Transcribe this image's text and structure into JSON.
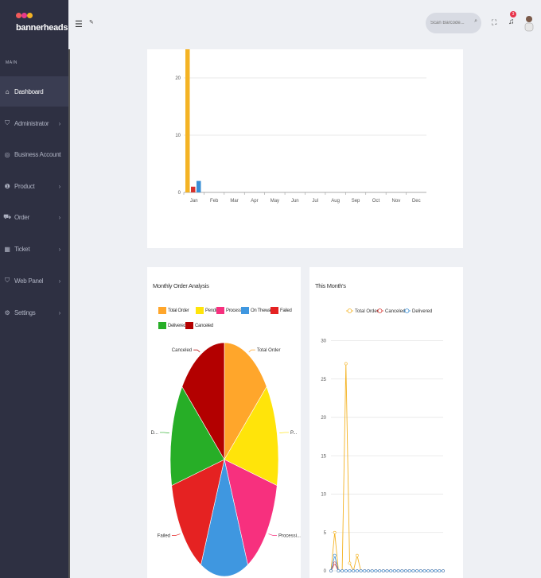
{
  "brand": {
    "name": "bannerheads",
    "dot_colors": [
      "#f15a5a",
      "#e63a8a",
      "#f4b324"
    ]
  },
  "sidebar": {
    "section_label": "MAIN",
    "items": [
      {
        "label": "Dashboard",
        "icon": "home-icon",
        "active": true
      },
      {
        "label": "Administrator",
        "icon": "shield-icon"
      },
      {
        "label": "Business Account",
        "icon": "account-icon"
      },
      {
        "label": "Product",
        "icon": "product-icon"
      },
      {
        "label": "Order",
        "icon": "cart-icon"
      },
      {
        "label": "Ticket",
        "icon": "ticket-icon"
      },
      {
        "label": "Web Panel",
        "icon": "web-icon"
      },
      {
        "label": "Settings",
        "icon": "gear-icon"
      }
    ]
  },
  "header": {
    "search_placeholder": "Scan Barcode...",
    "notification_count": "3",
    "icons": [
      "menu-icon",
      "pin-icon",
      "search-icon",
      "fullscreen-icon",
      "bell-icon",
      "user-avatar"
    ]
  },
  "chart_data": [
    {
      "type": "bar",
      "title": "",
      "categories": [
        "Jan",
        "Feb",
        "Mar",
        "Apr",
        "May",
        "Jun",
        "Jul",
        "Aug",
        "Sep",
        "Oct",
        "Nov",
        "Dec"
      ],
      "series": [
        {
          "color": "#f4b324",
          "values": [
            27,
            0,
            0,
            0,
            0,
            0,
            0,
            0,
            0,
            0,
            0,
            0
          ]
        },
        {
          "color": "#d7322e",
          "values": [
            1,
            0,
            0,
            0,
            0,
            0,
            0,
            0,
            0,
            0,
            0,
            0
          ]
        },
        {
          "color": "#3a8fd6",
          "values": [
            2,
            0,
            0,
            0,
            0,
            0,
            0,
            0,
            0,
            0,
            0,
            0
          ]
        }
      ],
      "ylim": [
        0,
        25
      ],
      "yticks": [
        0,
        10,
        20
      ],
      "grid": true
    },
    {
      "type": "pie",
      "title": "Monthly Order Analysis",
      "legend": [
        {
          "label": "Total Order",
          "color": "#ffa62b"
        },
        {
          "label": "Pending",
          "color": "#ffe40a"
        },
        {
          "label": "Processing",
          "color": "#f7307e"
        },
        {
          "label": "On Theway",
          "color": "#3f97e0"
        },
        {
          "label": "Failed",
          "color": "#e52222"
        },
        {
          "label": "Delivered",
          "color": "#27ae27"
        },
        {
          "label": "Canceled",
          "color": "#b30000"
        }
      ],
      "values": [
        1,
        1,
        1,
        1,
        1,
        1,
        1
      ],
      "slice_labels": [
        "Total Order",
        "P...",
        "Processi...",
        "",
        "Failed",
        "D...",
        "Canceled"
      ],
      "legend_position": "top"
    },
    {
      "type": "line",
      "title": "This Month's",
      "series": [
        {
          "name": "Total Order",
          "color": "#f4b324",
          "values": [
            0,
            5,
            0,
            0,
            27,
            1,
            0,
            2,
            0,
            0,
            0,
            0,
            0,
            0,
            0,
            0,
            0,
            0,
            0,
            0,
            0,
            0,
            0,
            0,
            0,
            0,
            0,
            0,
            0,
            0,
            0
          ]
        },
        {
          "name": "Canceled",
          "color": "#d7322e",
          "values": [
            0,
            1,
            0,
            0,
            0,
            0,
            0,
            0,
            0,
            0,
            0,
            0,
            0,
            0,
            0,
            0,
            0,
            0,
            0,
            0,
            0,
            0,
            0,
            0,
            0,
            0,
            0,
            0,
            0,
            0,
            0
          ]
        },
        {
          "name": "Delivered",
          "color": "#3a8fd6",
          "values": [
            0,
            2,
            0,
            0,
            0,
            0,
            0,
            0,
            0,
            0,
            0,
            0,
            0,
            0,
            0,
            0,
            0,
            0,
            0,
            0,
            0,
            0,
            0,
            0,
            0,
            0,
            0,
            0,
            0,
            0,
            0
          ]
        }
      ],
      "ylim": [
        0,
        30
      ],
      "yticks": [
        0,
        5,
        10,
        15,
        20,
        25,
        30
      ],
      "grid": true,
      "legend_position": "top"
    }
  ]
}
